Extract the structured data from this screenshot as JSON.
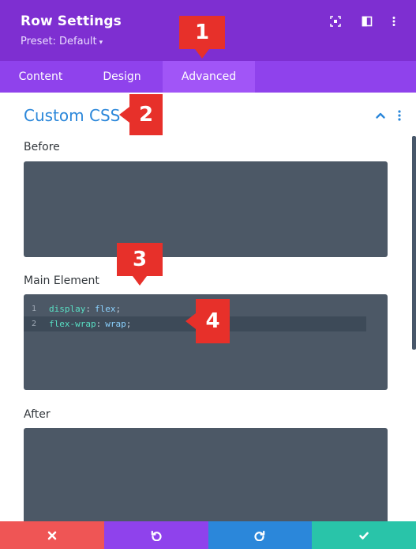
{
  "header": {
    "title": "Row Settings",
    "preset": "Preset: Default",
    "icons": [
      "focus-icon",
      "sidebar-layout-icon",
      "more-vertical-icon"
    ]
  },
  "tabs": [
    {
      "label": "Content",
      "active": false
    },
    {
      "label": "Design",
      "active": false
    },
    {
      "label": "Advanced",
      "active": true
    }
  ],
  "section": {
    "title": "Custom CSS",
    "fields": {
      "before": {
        "label": "Before"
      },
      "main": {
        "label": "Main Element",
        "code": [
          {
            "num": "1",
            "prop": "display",
            "value": "flex"
          },
          {
            "num": "2",
            "prop": "flex-wrap",
            "value": "wrap"
          }
        ]
      },
      "after": {
        "label": "After"
      }
    }
  },
  "callouts": [
    "1",
    "2",
    "3",
    "4"
  ],
  "footer": {
    "buttons": [
      "cancel-icon",
      "undo-icon",
      "redo-icon",
      "save-check-icon"
    ]
  },
  "colors": {
    "header": "#7e2fd1",
    "tabs": "#8f42ec",
    "active_tab": "#a155f7",
    "accent_blue": "#2b87da",
    "editor_bg": "#4c5866",
    "callout": "#e7302a",
    "cancel": "#ef5555",
    "undo": "#8f42ec",
    "redo": "#2b87da",
    "save": "#29c4a9"
  }
}
